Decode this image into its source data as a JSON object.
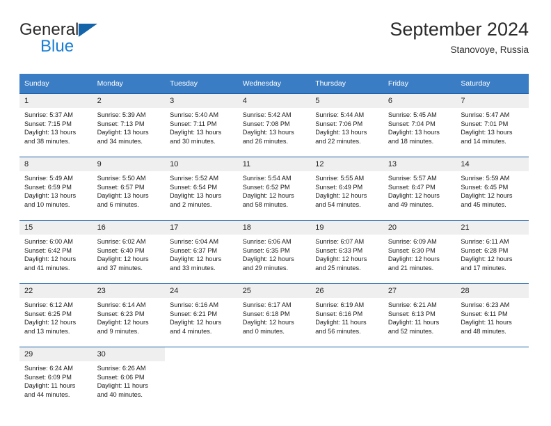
{
  "brand": {
    "name_part1": "General",
    "name_part2": "Blue",
    "flag_icon": "triangle-flag-icon",
    "accent_color": "#1464aa",
    "secondary_color": "#1a7fd4"
  },
  "header": {
    "title": "September 2024",
    "subtitle": "Stanovoye, Russia"
  },
  "theme": {
    "header_row_color": "#3b7dc4",
    "row_divider_color": "#1a5fa8",
    "daynum_band_color": "#efefef",
    "text_color": "#1a1a1a"
  },
  "weekday_headers": [
    "Sunday",
    "Monday",
    "Tuesday",
    "Wednesday",
    "Thursday",
    "Friday",
    "Saturday"
  ],
  "labels": {
    "sunrise_prefix": "Sunrise:",
    "sunset_prefix": "Sunset:",
    "daylight_prefix": "Daylight:"
  },
  "weeks": [
    [
      {
        "day": "1",
        "sunrise": "Sunrise: 5:37 AM",
        "sunset": "Sunset: 7:15 PM",
        "daylight_line1": "Daylight: 13 hours",
        "daylight_line2": "and 38 minutes."
      },
      {
        "day": "2",
        "sunrise": "Sunrise: 5:39 AM",
        "sunset": "Sunset: 7:13 PM",
        "daylight_line1": "Daylight: 13 hours",
        "daylight_line2": "and 34 minutes."
      },
      {
        "day": "3",
        "sunrise": "Sunrise: 5:40 AM",
        "sunset": "Sunset: 7:11 PM",
        "daylight_line1": "Daylight: 13 hours",
        "daylight_line2": "and 30 minutes."
      },
      {
        "day": "4",
        "sunrise": "Sunrise: 5:42 AM",
        "sunset": "Sunset: 7:08 PM",
        "daylight_line1": "Daylight: 13 hours",
        "daylight_line2": "and 26 minutes."
      },
      {
        "day": "5",
        "sunrise": "Sunrise: 5:44 AM",
        "sunset": "Sunset: 7:06 PM",
        "daylight_line1": "Daylight: 13 hours",
        "daylight_line2": "and 22 minutes."
      },
      {
        "day": "6",
        "sunrise": "Sunrise: 5:45 AM",
        "sunset": "Sunset: 7:04 PM",
        "daylight_line1": "Daylight: 13 hours",
        "daylight_line2": "and 18 minutes."
      },
      {
        "day": "7",
        "sunrise": "Sunrise: 5:47 AM",
        "sunset": "Sunset: 7:01 PM",
        "daylight_line1": "Daylight: 13 hours",
        "daylight_line2": "and 14 minutes."
      }
    ],
    [
      {
        "day": "8",
        "sunrise": "Sunrise: 5:49 AM",
        "sunset": "Sunset: 6:59 PM",
        "daylight_line1": "Daylight: 13 hours",
        "daylight_line2": "and 10 minutes."
      },
      {
        "day": "9",
        "sunrise": "Sunrise: 5:50 AM",
        "sunset": "Sunset: 6:57 PM",
        "daylight_line1": "Daylight: 13 hours",
        "daylight_line2": "and 6 minutes."
      },
      {
        "day": "10",
        "sunrise": "Sunrise: 5:52 AM",
        "sunset": "Sunset: 6:54 PM",
        "daylight_line1": "Daylight: 13 hours",
        "daylight_line2": "and 2 minutes."
      },
      {
        "day": "11",
        "sunrise": "Sunrise: 5:54 AM",
        "sunset": "Sunset: 6:52 PM",
        "daylight_line1": "Daylight: 12 hours",
        "daylight_line2": "and 58 minutes."
      },
      {
        "day": "12",
        "sunrise": "Sunrise: 5:55 AM",
        "sunset": "Sunset: 6:49 PM",
        "daylight_line1": "Daylight: 12 hours",
        "daylight_line2": "and 54 minutes."
      },
      {
        "day": "13",
        "sunrise": "Sunrise: 5:57 AM",
        "sunset": "Sunset: 6:47 PM",
        "daylight_line1": "Daylight: 12 hours",
        "daylight_line2": "and 49 minutes."
      },
      {
        "day": "14",
        "sunrise": "Sunrise: 5:59 AM",
        "sunset": "Sunset: 6:45 PM",
        "daylight_line1": "Daylight: 12 hours",
        "daylight_line2": "and 45 minutes."
      }
    ],
    [
      {
        "day": "15",
        "sunrise": "Sunrise: 6:00 AM",
        "sunset": "Sunset: 6:42 PM",
        "daylight_line1": "Daylight: 12 hours",
        "daylight_line2": "and 41 minutes."
      },
      {
        "day": "16",
        "sunrise": "Sunrise: 6:02 AM",
        "sunset": "Sunset: 6:40 PM",
        "daylight_line1": "Daylight: 12 hours",
        "daylight_line2": "and 37 minutes."
      },
      {
        "day": "17",
        "sunrise": "Sunrise: 6:04 AM",
        "sunset": "Sunset: 6:37 PM",
        "daylight_line1": "Daylight: 12 hours",
        "daylight_line2": "and 33 minutes."
      },
      {
        "day": "18",
        "sunrise": "Sunrise: 6:06 AM",
        "sunset": "Sunset: 6:35 PM",
        "daylight_line1": "Daylight: 12 hours",
        "daylight_line2": "and 29 minutes."
      },
      {
        "day": "19",
        "sunrise": "Sunrise: 6:07 AM",
        "sunset": "Sunset: 6:33 PM",
        "daylight_line1": "Daylight: 12 hours",
        "daylight_line2": "and 25 minutes."
      },
      {
        "day": "20",
        "sunrise": "Sunrise: 6:09 AM",
        "sunset": "Sunset: 6:30 PM",
        "daylight_line1": "Daylight: 12 hours",
        "daylight_line2": "and 21 minutes."
      },
      {
        "day": "21",
        "sunrise": "Sunrise: 6:11 AM",
        "sunset": "Sunset: 6:28 PM",
        "daylight_line1": "Daylight: 12 hours",
        "daylight_line2": "and 17 minutes."
      }
    ],
    [
      {
        "day": "22",
        "sunrise": "Sunrise: 6:12 AM",
        "sunset": "Sunset: 6:25 PM",
        "daylight_line1": "Daylight: 12 hours",
        "daylight_line2": "and 13 minutes."
      },
      {
        "day": "23",
        "sunrise": "Sunrise: 6:14 AM",
        "sunset": "Sunset: 6:23 PM",
        "daylight_line1": "Daylight: 12 hours",
        "daylight_line2": "and 9 minutes."
      },
      {
        "day": "24",
        "sunrise": "Sunrise: 6:16 AM",
        "sunset": "Sunset: 6:21 PM",
        "daylight_line1": "Daylight: 12 hours",
        "daylight_line2": "and 4 minutes."
      },
      {
        "day": "25",
        "sunrise": "Sunrise: 6:17 AM",
        "sunset": "Sunset: 6:18 PM",
        "daylight_line1": "Daylight: 12 hours",
        "daylight_line2": "and 0 minutes."
      },
      {
        "day": "26",
        "sunrise": "Sunrise: 6:19 AM",
        "sunset": "Sunset: 6:16 PM",
        "daylight_line1": "Daylight: 11 hours",
        "daylight_line2": "and 56 minutes."
      },
      {
        "day": "27",
        "sunrise": "Sunrise: 6:21 AM",
        "sunset": "Sunset: 6:13 PM",
        "daylight_line1": "Daylight: 11 hours",
        "daylight_line2": "and 52 minutes."
      },
      {
        "day": "28",
        "sunrise": "Sunrise: 6:23 AM",
        "sunset": "Sunset: 6:11 PM",
        "daylight_line1": "Daylight: 11 hours",
        "daylight_line2": "and 48 minutes."
      }
    ],
    [
      {
        "day": "29",
        "sunrise": "Sunrise: 6:24 AM",
        "sunset": "Sunset: 6:09 PM",
        "daylight_line1": "Daylight: 11 hours",
        "daylight_line2": "and 44 minutes."
      },
      {
        "day": "30",
        "sunrise": "Sunrise: 6:26 AM",
        "sunset": "Sunset: 6:06 PM",
        "daylight_line1": "Daylight: 11 hours",
        "daylight_line2": "and 40 minutes."
      },
      {
        "day": "",
        "sunrise": "",
        "sunset": "",
        "daylight_line1": "",
        "daylight_line2": ""
      },
      {
        "day": "",
        "sunrise": "",
        "sunset": "",
        "daylight_line1": "",
        "daylight_line2": ""
      },
      {
        "day": "",
        "sunrise": "",
        "sunset": "",
        "daylight_line1": "",
        "daylight_line2": ""
      },
      {
        "day": "",
        "sunrise": "",
        "sunset": "",
        "daylight_line1": "",
        "daylight_line2": ""
      },
      {
        "day": "",
        "sunrise": "",
        "sunset": "",
        "daylight_line1": "",
        "daylight_line2": ""
      }
    ]
  ]
}
